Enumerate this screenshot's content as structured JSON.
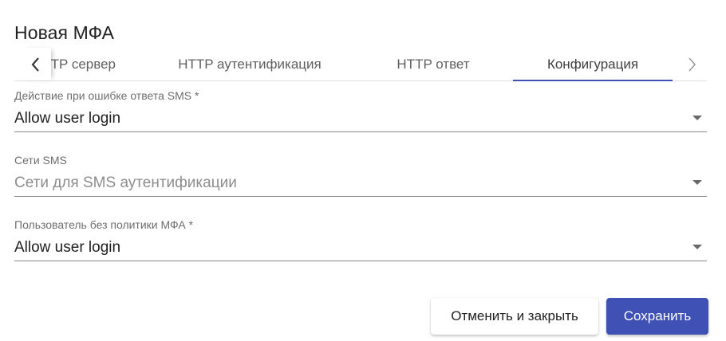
{
  "dialog": {
    "title": "Новая МФА"
  },
  "tabs": {
    "items": [
      {
        "label": "HTTP сервер"
      },
      {
        "label": "HTTP аутентификация"
      },
      {
        "label": "HTTP ответ"
      },
      {
        "label": "Конфигурация"
      }
    ],
    "active_index": 3,
    "scroll_left_icon": "chevron-left-icon",
    "scroll_right_icon": "chevron-right-icon"
  },
  "fields": [
    {
      "label": "Действие при ошибке ответа SMS *",
      "value": "Allow user login",
      "placeholder": ""
    },
    {
      "label": "Сети SMS",
      "value": "",
      "placeholder": "Сети для SMS аутентификации"
    },
    {
      "label": "Пользователь без политики МФА *",
      "value": "Allow user login",
      "placeholder": ""
    }
  ],
  "actions": {
    "cancel_label": "Отменить и закрыть",
    "save_label": "Сохранить"
  },
  "colors": {
    "accent": "#3f51b5",
    "text": "#212121",
    "placeholder": "#8d8d8d"
  }
}
